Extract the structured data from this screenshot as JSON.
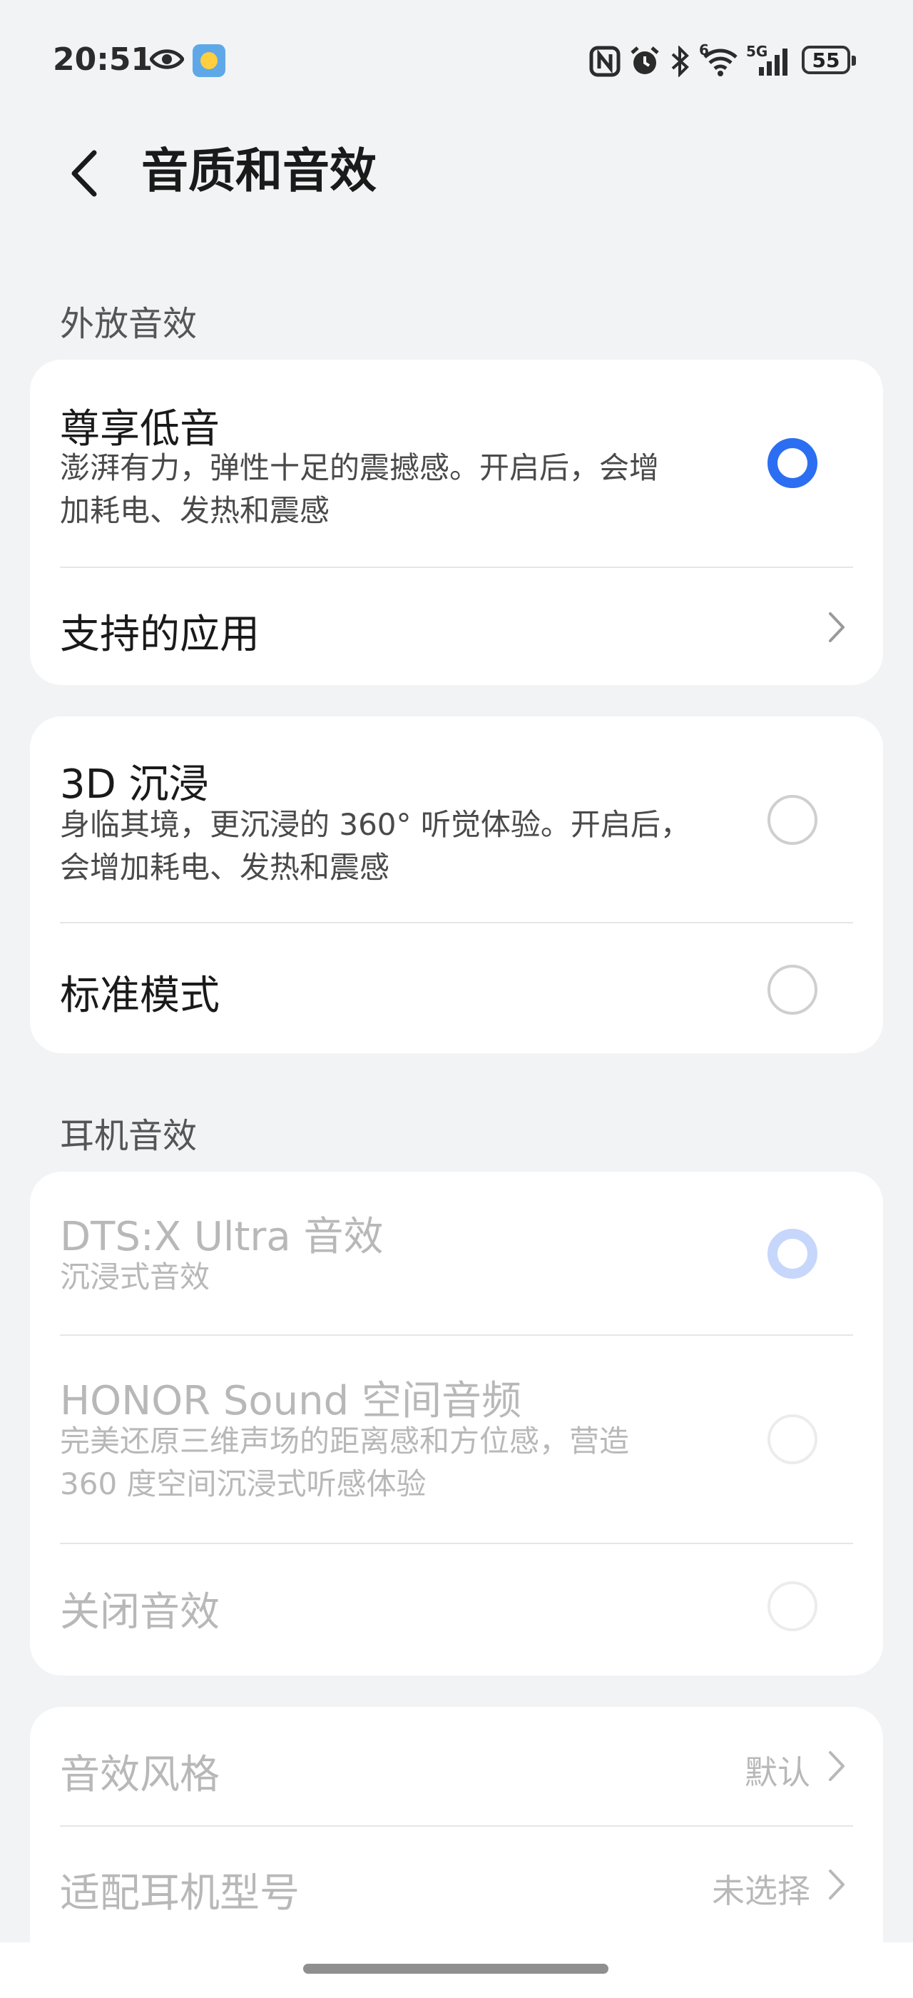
{
  "status_bar": {
    "time": "20:51",
    "battery": "55",
    "signal_label": "5G",
    "wifi_label": "6",
    "icons": [
      "eye-icon",
      "weather-icon",
      "nfc-icon",
      "alarm-icon",
      "bluetooth-icon",
      "wifi-icon",
      "signal-icon",
      "battery-icon"
    ]
  },
  "header": {
    "title": "音质和音效",
    "back_icon": "chevron-left-icon"
  },
  "speaker": {
    "section_label": "外放音效",
    "options": [
      {
        "title": "尊享低音",
        "subtitle_line1": "澎湃有力，弹性十足的震撼感。开启后，会增",
        "subtitle_line2": "加耗电、发热和震感",
        "selected": true
      },
      {
        "title": "3D 沉浸",
        "subtitle_line1": "身临其境，更沉浸的 360° 听觉体验。开启后，",
        "subtitle_line2": "会增加耗电、发热和震感",
        "selected": false
      },
      {
        "title": "标准模式",
        "selected": false
      }
    ],
    "supported_apps": "支持的应用"
  },
  "headphone": {
    "section_label": "耳机音效",
    "options": [
      {
        "title": "DTS:X Ultra 音效",
        "subtitle_line1": "沉浸式音效",
        "selected": true
      },
      {
        "title": "HONOR Sound 空间音频",
        "subtitle_line1": "完美还原三维声场的距离感和方位感，营造",
        "subtitle_line2": "360 度空间沉浸式听感体验",
        "selected": false
      },
      {
        "title": "关闭音效",
        "selected": false
      }
    ],
    "style": {
      "label": "音效风格",
      "value": "默认"
    },
    "model": {
      "label": "适配耳机型号",
      "value": "未选择"
    }
  },
  "colors": {
    "accent": "#2c6ef2",
    "background": "#f1f3f5",
    "card": "#ffffff",
    "disabled_text": "#b8b8b8"
  }
}
